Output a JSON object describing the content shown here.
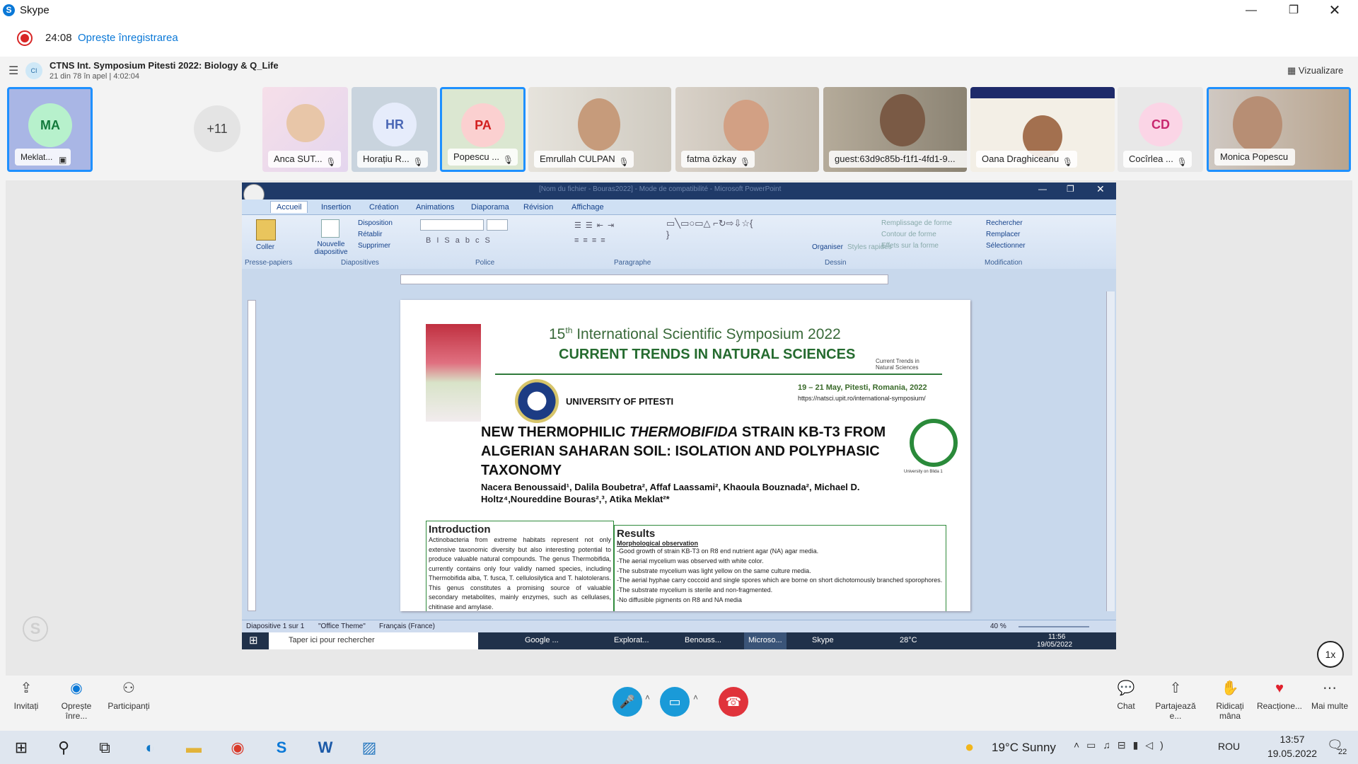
{
  "window": {
    "title": "Skype"
  },
  "recording": {
    "time": "24:08",
    "stop_label": "Oprește înregistrarea"
  },
  "call": {
    "badge": "CI",
    "title": "CTNS Int. Symposium Pitesti 2022: Biology & Q_Life",
    "subtitle": "21 din 78 în apel | 4:02:04",
    "view_label": "Vizualizare"
  },
  "participants": {
    "overflow": "+11",
    "tiles": [
      {
        "name": "Meklat...",
        "initials": "MA",
        "color": "#3bd17a"
      },
      {
        "name": "Anca SUT..."
      },
      {
        "name": "Horațiu R...",
        "initials": "HR",
        "color": "#6a8fd8"
      },
      {
        "name": "Popescu ...",
        "initials": "PA",
        "color": "#e0302e"
      },
      {
        "name": "Emrullah CULPAN"
      },
      {
        "name": "fatma özkay"
      },
      {
        "name": "guest:63d9c85b-f1f1-4fd1-9..."
      },
      {
        "name": "Oana Draghiceanu"
      },
      {
        "name": "Cocîrlea ...",
        "initials": "CD",
        "color": "#e83a8a"
      },
      {
        "name": "Monica Popescu"
      }
    ]
  },
  "ppt": {
    "window_title": "[Nom du fichier - Bouras2022] - Mode de compatibilité - Microsoft PowerPoint",
    "tabs": [
      "Accueil",
      "Insertion",
      "Création",
      "Animations",
      "Diaporama",
      "Révision",
      "Affichage"
    ],
    "groups": {
      "clipboard": "Presse-papiers",
      "slides": "Diapositives",
      "font": "Police",
      "paragraph": "Paragraphe",
      "drawing": "Dessin",
      "editing": "Modification"
    },
    "buttons": {
      "paste": "Coller",
      "new_slide": "Nouvelle diapositive",
      "layout": "Disposition",
      "reset": "Rétablir",
      "delete": "Supprimer",
      "arrange": "Organiser",
      "styles": "Styles rapides",
      "fill": "Remplissage de forme",
      "outline": "Contour de forme",
      "effects": "Effets sur la forme",
      "find": "Rechercher",
      "replace": "Remplacer",
      "select": "Sélectionner"
    },
    "status": {
      "slide": "Diapositive 1 sur 1",
      "theme": "\"Office Theme\"",
      "lang": "Français (France)",
      "zoom": "40 %"
    }
  },
  "poster": {
    "edition": "15",
    "edition_sup": "th",
    "symposium": " International Scientific Symposium 2022",
    "subtitle": "CURRENT TRENDS IN NATURAL SCIENCES",
    "logo_text": "Current Trends in Natural Sciences",
    "university": "UNIVERSITY OF PITESTI",
    "dates": "19 – 21 May, Pitesti, Romania, 2022",
    "url": "https://natsci.upit.ro/international-symposium/",
    "uni_logo_caption": "University on Blida 1",
    "title_1": "NEW THERMOPHILIC ",
    "title_italic": "THERMOBIFIDA",
    "title_2": " STRAIN KB-T3 FROM ALGERIAN SAHARAN SOIL: ISOLATION AND POLYPHASIC TAXONOMY",
    "authors": "Nacera Benoussaid¹, Dalila Boubetra², Affaf Laassami², Khaoula Bouznada², Michael D. Holtz⁴,Noureddine Bouras²,³, Atika Meklat²*",
    "intro_heading": "Introduction",
    "intro_text": "Actinobacteria from extreme habitats represent not only extensive taxonomic diversity but also interesting potential to produce valuable natural compounds. The genus Thermobifida, currently contains only four validly named species, including Thermobifida alba, T. fusca, T. cellulosilytica and T. halotolerans. This genus constitutes a promising source of valuable secondary metabolites, mainly enzymes, such as cellulases, chitinase and amylase.",
    "results_heading": "Results",
    "results_sub": "Morphological observation",
    "results_lines": [
      "-Good growth of strain KB-T3 on R8 end nutrient agar (NA) agar media.",
      "-The aerial mycelium was observed with white color.",
      "-The substrate mycelium was light yellow on the same culture media.",
      "-The aerial hyphae carry coccoid and single spores which are borne on short dichotomously branched sporophores.",
      "-The substrate mycelium is sterile and non-fragmented.",
      "-No diffusible pigments on R8 and NA media"
    ]
  },
  "remote_taskbar": {
    "search": "Taper ici pour rechercher",
    "apps": [
      "Google ...",
      "Explorat...",
      "Benouss...",
      "Microso...",
      "Skype"
    ],
    "temp": "28°C",
    "time": "11:56",
    "date": "19/05/2022"
  },
  "speed": "1x",
  "controls": {
    "invite": "Invitați",
    "stop_rec": "Oprește înre...",
    "participants": "Participanți",
    "chat": "Chat",
    "share": "Partajează e...",
    "raise": "Ridicați mâna",
    "react": "Reacțione...",
    "more": "Mai multe"
  },
  "taskbar": {
    "weather": "19°C  Sunny",
    "lang": "ROU",
    "time": "13:57",
    "date": "19.05.2022",
    "notif": "22"
  }
}
